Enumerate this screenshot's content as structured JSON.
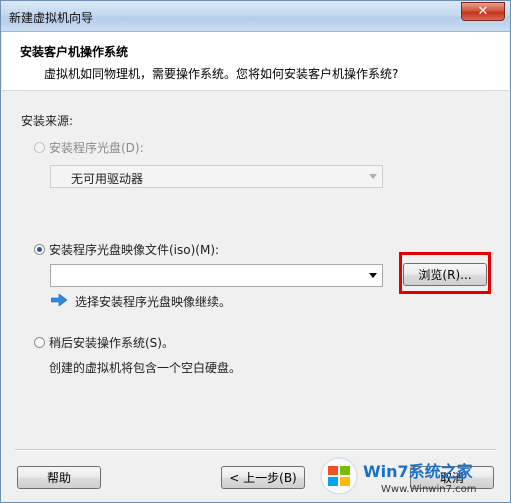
{
  "window": {
    "title": "新建虚拟机向导",
    "close_glyph": "✕"
  },
  "header": {
    "title": "安装客户机操作系统",
    "subtitle": "虚拟机如同物理机，需要操作系统。您将如何安装客户机操作系统?"
  },
  "install_source": {
    "label": "安装来源:",
    "disc_option": {
      "label": "安装程序光盘(D):",
      "selected": false,
      "disabled": true,
      "drive_select_value": "无可用驱动器"
    },
    "iso_option": {
      "label": "安装程序光盘映像文件(iso)(M):",
      "selected": true,
      "path_value": "",
      "browse_label": "浏览(R)...",
      "hint": "选择安装程序光盘映像继续。"
    },
    "later_option": {
      "label": "稍后安装操作系统(S)。",
      "selected": false,
      "description": "创建的虚拟机将包含一个空白硬盘。"
    }
  },
  "footer": {
    "help_label": "帮助",
    "back_label": "< 上一步(B)",
    "cancel_label": "取消"
  },
  "watermark": {
    "logo_text": "Win7系统之家",
    "url": "Www.Winwin7.com"
  },
  "colors": {
    "highlight": "#e10000",
    "accent_arrow": "#2f8be0"
  }
}
